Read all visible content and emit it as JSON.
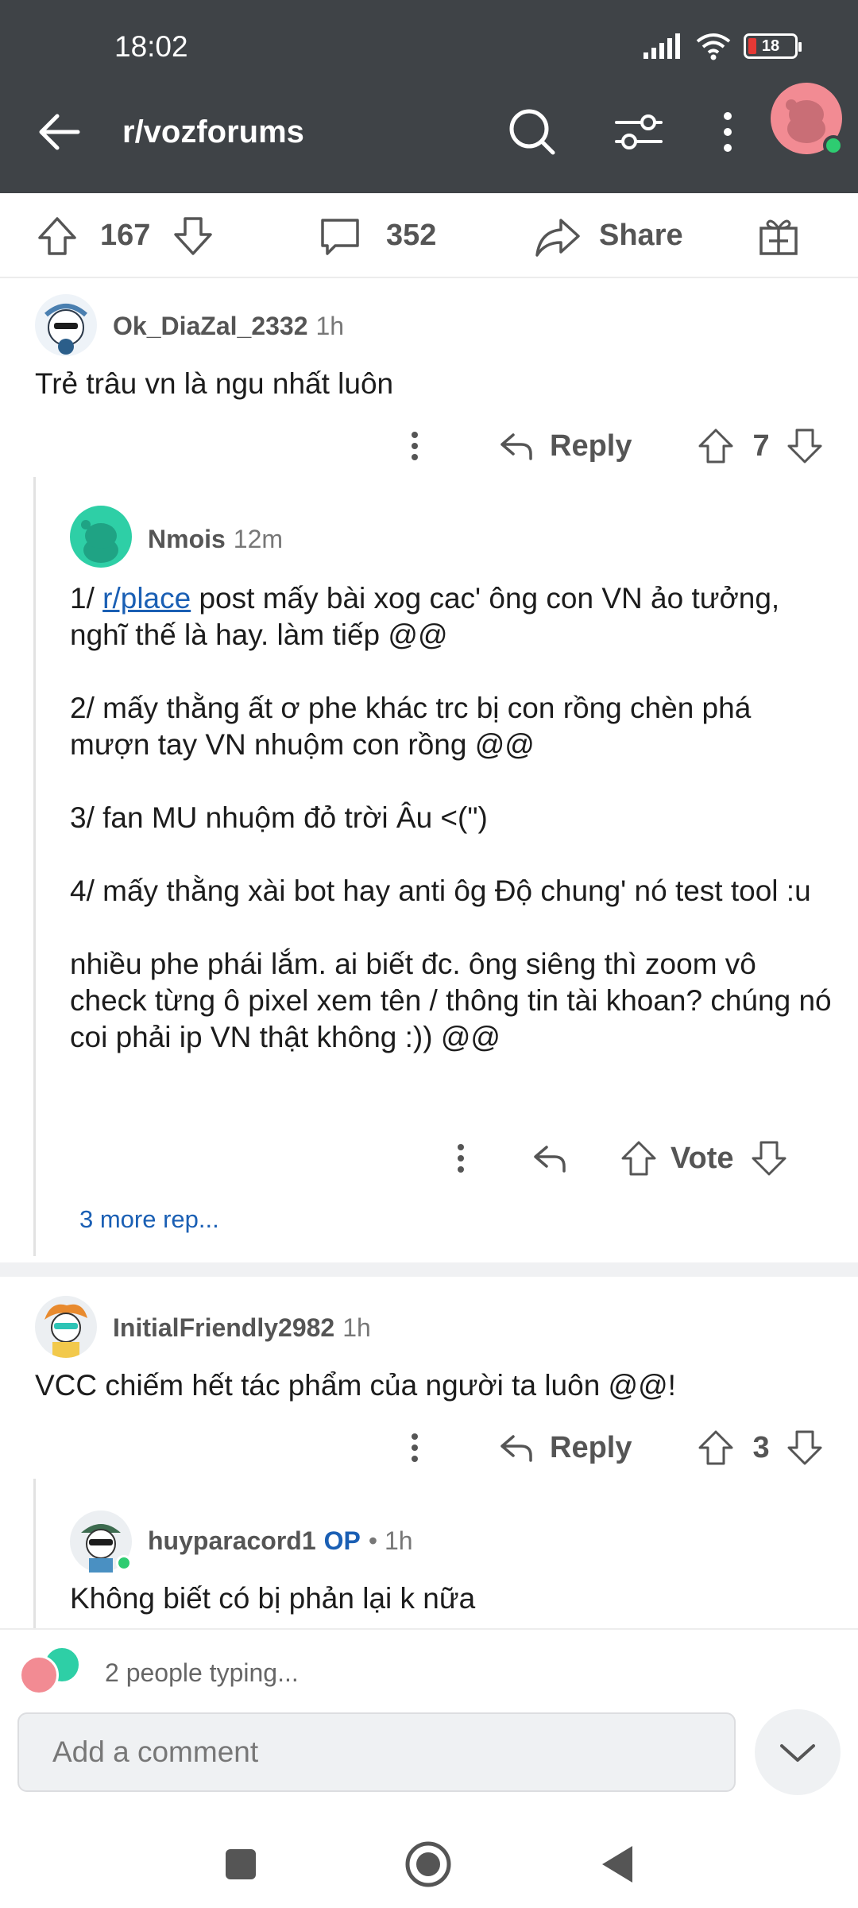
{
  "status_bar": {
    "time": "18:02",
    "battery_level": "18"
  },
  "header": {
    "title": "r/vozforums"
  },
  "post_actions": {
    "upvotes": "167",
    "comments": "352",
    "share_label": "Share"
  },
  "comments": [
    {
      "username": "Ok_DiaZal_2332",
      "time": "1h",
      "body": "Trẻ trâu vn là ngu nhất luôn",
      "reply_label": "Reply",
      "votes": "7"
    },
    {
      "username": "Nmois",
      "time": "12m",
      "paragraphs": {
        "p1_prefix": "1/ ",
        "p1_link": "r/place",
        "p1_suffix": " post mấy bài xog cac' ông con VN ảo tưởng, nghĩ thế là hay. làm tiếp @@",
        "p2": "2/ mấy thằng ất ơ phe khác trc bị con rồng chèn phá mượn tay VN nhuộm con rồng @@",
        "p3": "3/ fan MU nhuộm đỏ trời Âu <(\")",
        "p4": "4/ mấy thằng xài bot hay anti ôg Độ chung' nó test tool :u",
        "p5": "nhiều phe phái lắm. ai biết đc. ông siêng thì zoom vô check từng ô pixel xem tên / thông tin tài khoan? chúng nó coi phải ip VN thật không :)) @@"
      },
      "vote_label": "Vote",
      "more_replies": "3 more rep..."
    },
    {
      "username": "InitialFriendly2982",
      "time": "1h",
      "body": "VCC chiếm hết tác phẩm của người ta luôn @@!",
      "reply_label": "Reply",
      "votes": "3"
    },
    {
      "username": "huyparacord1",
      "op_tag": "OP",
      "time": "• 1h",
      "body": "Không biết có bị phản lại k nữa"
    }
  ],
  "bottom": {
    "typing_text": "2 people typing...",
    "comment_placeholder": "Add a comment"
  },
  "colors": {
    "header_bg": "#3f4347",
    "link": "#1a5fb4",
    "online": "#2ecc71"
  },
  "icons": [
    "back-arrow-icon",
    "search-icon",
    "filter-icon",
    "more-vert-icon",
    "upvote-icon",
    "downvote-icon",
    "comment-icon",
    "share-icon",
    "award-icon",
    "reply-icon",
    "chevron-down-icon"
  ]
}
